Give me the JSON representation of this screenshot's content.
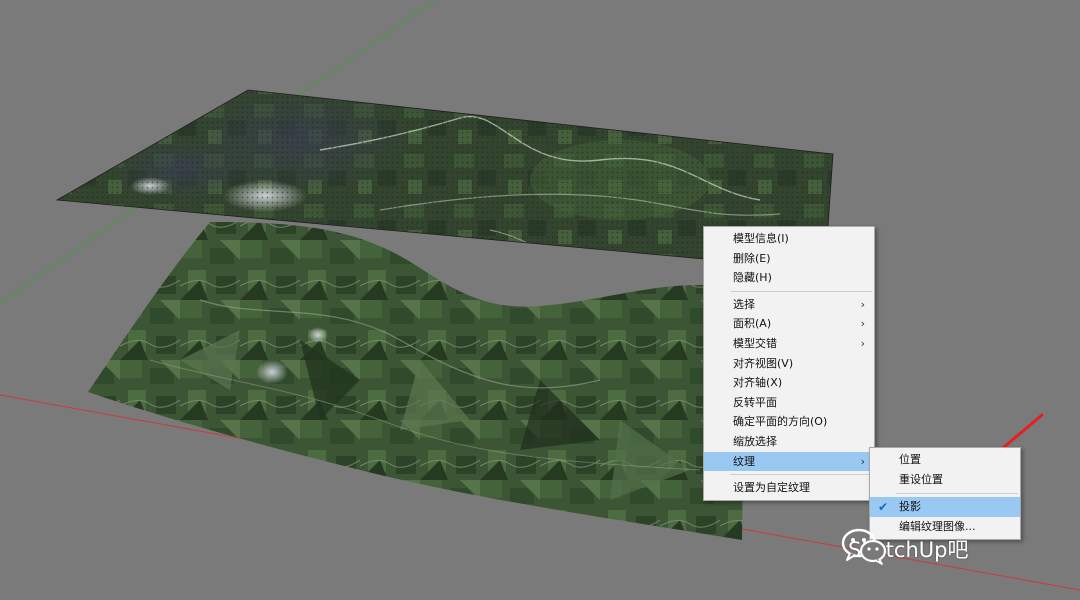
{
  "context_menu": {
    "items": [
      {
        "label": "模型信息(I)"
      },
      {
        "label": "删除(E)"
      },
      {
        "label": "隐藏(H)"
      },
      {
        "label": "选择",
        "submenu": true
      },
      {
        "label": "面积(A)",
        "submenu": true
      },
      {
        "label": "模型交错",
        "submenu": true
      },
      {
        "label": "对齐视图(V)"
      },
      {
        "label": "对齐轴(X)"
      },
      {
        "label": "反转平面"
      },
      {
        "label": "确定平面的方向(O)"
      },
      {
        "label": "缩放选择"
      },
      {
        "label": "纹理",
        "submenu": true,
        "highlighted": true
      },
      {
        "label": "设置为自定纹理"
      }
    ]
  },
  "texture_submenu": {
    "items": [
      {
        "label": "位置"
      },
      {
        "label": "重设位置"
      },
      {
        "label": "投影",
        "checked": true,
        "highlighted": true
      },
      {
        "label": "编辑纹理图像..."
      }
    ]
  },
  "watermark": {
    "text": "SketchUp吧",
    "icon": "wechat-icon"
  },
  "colors": {
    "background": "#7a7a7a",
    "menu_background": "#f2f2f2",
    "highlight": "#99c9f2",
    "annotation_arrow": "#e81e1e",
    "axis_red": "#c83c3c",
    "axis_green": "#3ca03c"
  }
}
